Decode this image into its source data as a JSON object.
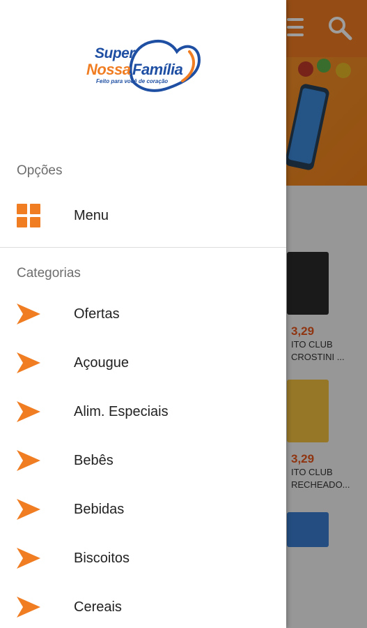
{
  "colors": {
    "accent": "#f07d22",
    "brand_blue": "#1e4fa3",
    "price": "#e7561c",
    "scrim": "rgba(0,0,0,0.38)"
  },
  "drawer": {
    "logo": {
      "word_super": "Super",
      "word_nossa": "Nossa",
      "word_familia": "Família",
      "tagline": "Feito para você de coração"
    },
    "options_header": "Opções",
    "menu_item": {
      "label": "Menu",
      "icon": "grid-icon"
    },
    "categories_header": "Categorias",
    "categories": [
      {
        "label": "Ofertas",
        "icon": "arrow-right-icon"
      },
      {
        "label": "Açougue",
        "icon": "arrow-right-icon"
      },
      {
        "label": "Alim. Especiais",
        "icon": "arrow-right-icon"
      },
      {
        "label": "Bebês",
        "icon": "arrow-right-icon"
      },
      {
        "label": "Bebidas",
        "icon": "arrow-right-icon"
      },
      {
        "label": "Biscoitos",
        "icon": "arrow-right-icon"
      },
      {
        "label": "Cereais",
        "icon": "arrow-right-icon"
      }
    ]
  },
  "background": {
    "header_icons": [
      "hamburger-icon",
      "search-icon"
    ],
    "products": [
      {
        "price": "3,29",
        "name_line1": "ITO CLUB",
        "name_line2": "CROSTINI ..."
      },
      {
        "price": "3,29",
        "name_line1": "ITO CLUB",
        "name_line2": "RECHEADO..."
      }
    ]
  }
}
